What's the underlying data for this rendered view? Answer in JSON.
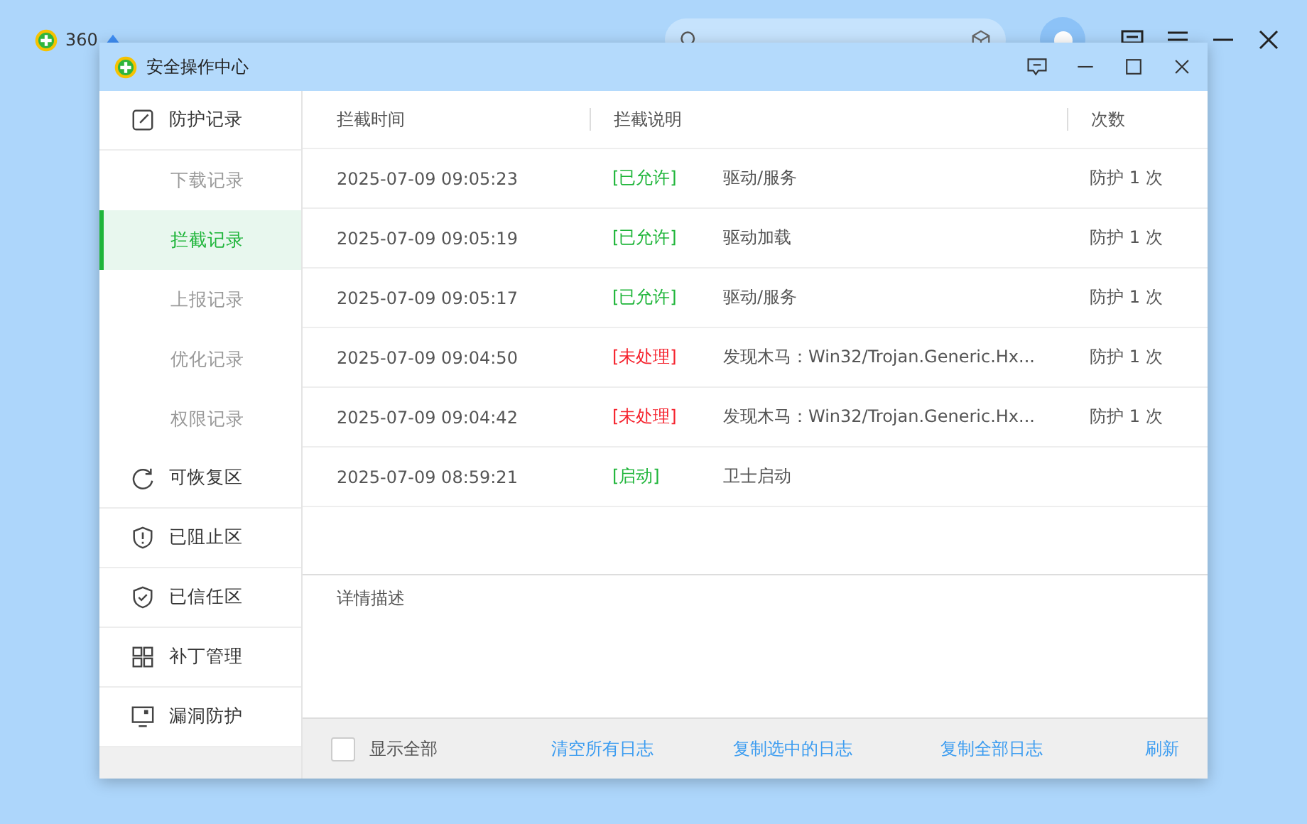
{
  "app": {
    "title": "360"
  },
  "window": {
    "title": "安全操作中心"
  },
  "sidebar": {
    "items": [
      {
        "label": "防护记录",
        "selected": false,
        "children": [
          {
            "label": "下载记录",
            "selected": false
          },
          {
            "label": "拦截记录",
            "selected": true
          },
          {
            "label": "上报记录",
            "selected": false
          },
          {
            "label": "优化记录",
            "selected": false
          },
          {
            "label": "权限记录",
            "selected": false
          }
        ]
      },
      {
        "label": "可恢复区",
        "selected": false
      },
      {
        "label": "已阻止区",
        "selected": false
      },
      {
        "label": "已信任区",
        "selected": false
      },
      {
        "label": "补丁管理",
        "selected": false
      },
      {
        "label": "漏洞防护",
        "selected": false
      }
    ]
  },
  "table": {
    "columns": [
      "拦截时间",
      "拦截说明",
      "次数"
    ],
    "rows": [
      {
        "time": "2025-07-09 09:05:23",
        "status": "[已允许]",
        "color": "#1fb53a",
        "description": "驱动/服务",
        "count": "防护 1 次"
      },
      {
        "time": "2025-07-09 09:05:19",
        "status": "[已允许]",
        "color": "#1fb53a",
        "description": "驱动加载",
        "count": "防护 1 次"
      },
      {
        "time": "2025-07-09 09:05:17",
        "status": "[已允许]",
        "color": "#1fb53a",
        "description": "驱动/服务",
        "count": "防护 1 次"
      },
      {
        "time": "2025-07-09 09:04:50",
        "status": "[未处理]",
        "color": "#f5222d",
        "description": "发现木马：Win32/Trojan.Generic.Hx...",
        "count": "防护 1 次"
      },
      {
        "time": "2025-07-09 09:04:42",
        "status": "[未处理]",
        "color": "#f5222d",
        "description": "发现木马：Win32/Trojan.Generic.Hx...",
        "count": "防护 1 次"
      },
      {
        "time": "2025-07-09 08:59:21",
        "status": "[启动]",
        "color": "#1fb53a",
        "description": "卫士启动"
      }
    ]
  },
  "details": {
    "label": "详情描述"
  },
  "footer": {
    "show_all": {
      "label": "显示全部",
      "checked": false
    },
    "links": [
      "清空所有日志",
      "复制选中的日志",
      "复制全部日志",
      "刷新"
    ]
  }
}
